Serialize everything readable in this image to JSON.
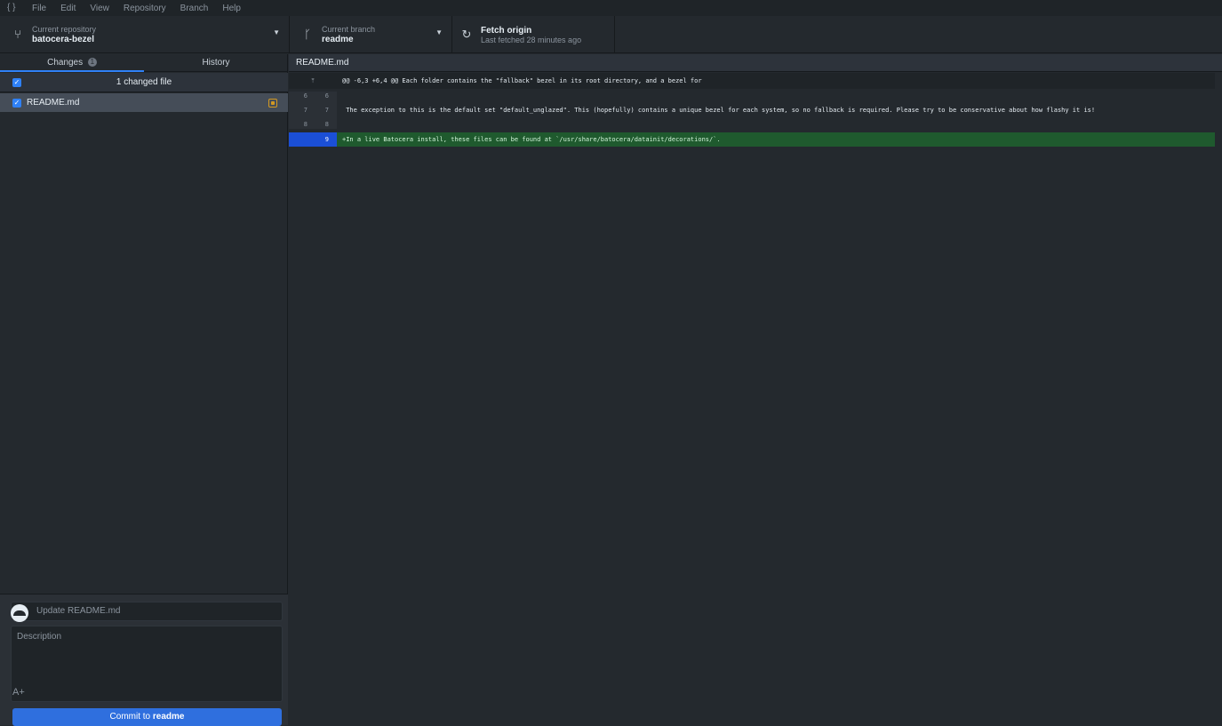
{
  "menubar": {
    "logo": "{ }",
    "items": [
      "File",
      "Edit",
      "View",
      "Repository",
      "Branch",
      "Help"
    ]
  },
  "toolbar": {
    "repository": {
      "label": "Current repository",
      "value": "batocera-bezel"
    },
    "branch": {
      "label": "Current branch",
      "value": "readme"
    },
    "fetch": {
      "label": "Fetch origin",
      "sub": "Last fetched 28 minutes ago"
    }
  },
  "left": {
    "tabs": [
      {
        "label": "Changes",
        "count": "1"
      },
      {
        "label": "History"
      }
    ],
    "changed_summary": "1 changed file",
    "files": [
      {
        "name": "README.md",
        "status": "modified"
      }
    ]
  },
  "commit": {
    "summary_placeholder": "Update README.md",
    "description_placeholder": "Description",
    "coauthor_icon": "A+",
    "button_prefix": "Commit to ",
    "button_branch": "readme"
  },
  "diff": {
    "file": "README.md",
    "hunk_marker": "⤒",
    "hunk": "@@ -6,3 +6,4 @@ Each folder contains the \"fallback\" bezel in its root directory, and a bezel for",
    "lines": [
      {
        "old": "6",
        "new": "6",
        "text": ""
      },
      {
        "old": "7",
        "new": "7",
        "text": " The exception to this is the default set \"default_unglazed\". This (hopefully) contains a unique bezel for each system, so no fallback is required. Please try to be conservative about how flashy it is!"
      },
      {
        "old": "8",
        "new": "8",
        "text": ""
      }
    ],
    "added": {
      "old": "",
      "new": "9",
      "text": "+In a live Batocera install, these files can be found at `/usr/share/batocera/datainit/decorations/`."
    }
  },
  "colors": {
    "accent": "#2f81f7",
    "added_bg": "#1f5a2e",
    "modified": "#d29922",
    "commit_button": "#2f6fde"
  }
}
